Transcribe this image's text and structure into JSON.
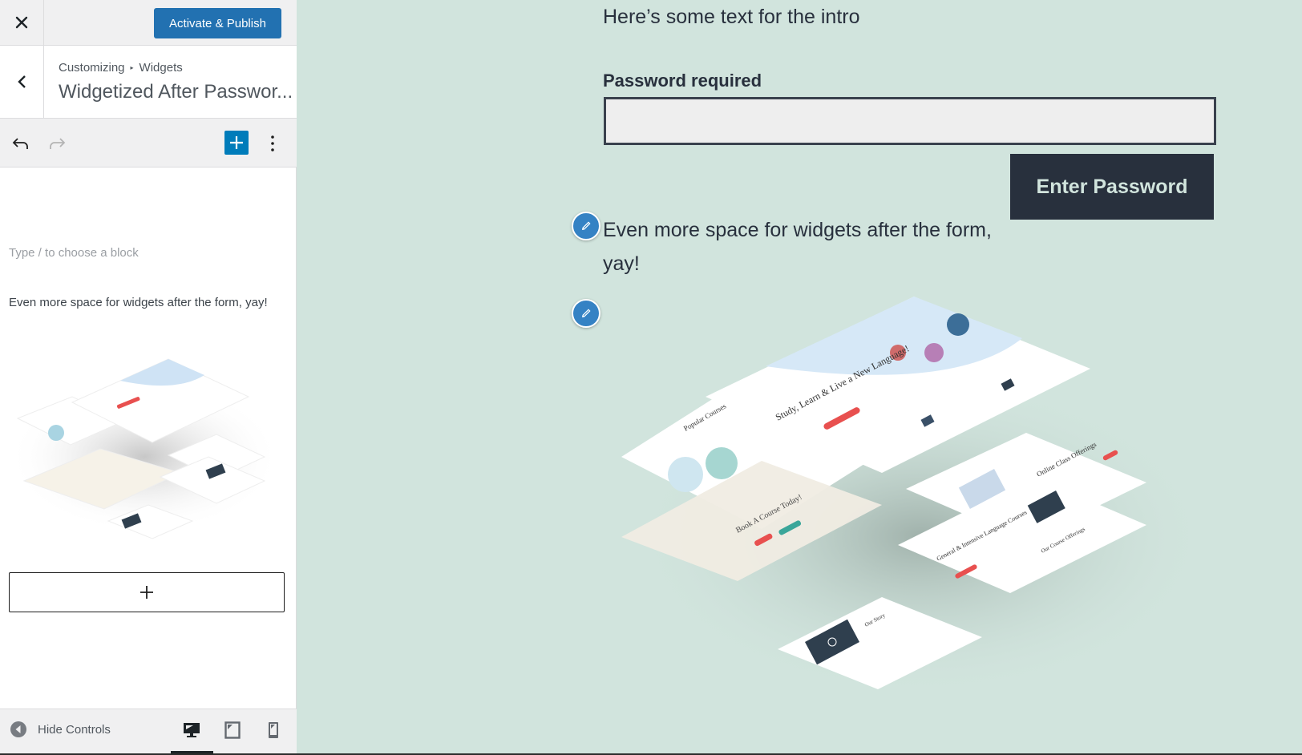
{
  "topbar": {
    "close_icon": "close-icon",
    "publish_label": "Activate & Publish",
    "publish_color": "#2271b1"
  },
  "section_header": {
    "back_icon": "chevron-left-icon",
    "breadcrumb": [
      "Customizing",
      "Widgets"
    ],
    "breadcrumb_separator": "▸",
    "title": "Widgetized After Passwor..."
  },
  "toolbar": {
    "undo_icon": "undo-icon",
    "redo_icon": "redo-icon",
    "inserter_icon": "plus-icon",
    "options_icon": "more-vertical-icon",
    "accent": "#007cba"
  },
  "editor": {
    "placeholder": "Type / to choose a block",
    "paragraph": "Even more space for widgets after the form, yay!",
    "image_alt": "Isometric stack of website page mockups",
    "add_block_icon": "plus-icon"
  },
  "footer": {
    "hide_controls_label": "Hide Controls",
    "devices": [
      {
        "name": "desktop",
        "icon": "desktop-icon",
        "active": true
      },
      {
        "name": "tablet",
        "icon": "tablet-icon",
        "active": false
      },
      {
        "name": "mobile",
        "icon": "mobile-icon",
        "active": false
      }
    ]
  },
  "preview": {
    "intro": "Here’s some text for the intro",
    "password_label": "Password required",
    "password_value": "",
    "submit_label": "Enter Password",
    "paragraph": "Even more space for widgets after the form, yay!",
    "edit_icon": "pencil-icon",
    "background": "#d1e4dd",
    "mockup_texts": {
      "hero": "Study, Learn & Live a New Language!",
      "popular": "Popular Courses",
      "book": "Book A Course Today!",
      "online": "Online Class Offerings",
      "general": "General & Intensive Language Courses",
      "offerings": "Our Course Offerings",
      "story": "Our Story"
    }
  }
}
